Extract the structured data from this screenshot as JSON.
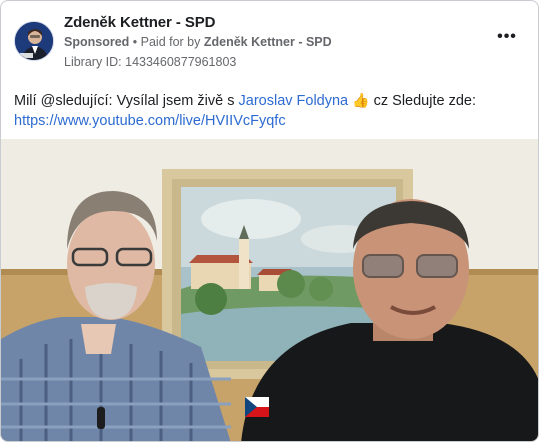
{
  "post": {
    "page_name": "Zdeněk Kettner - SPD",
    "sponsored_label": "Sponsored",
    "separator": " • ",
    "paid_for_prefix": "Paid for by ",
    "paid_for_by": "Zdeněk Kettner - SPD",
    "library_id": "Library ID: 1433460877961803",
    "more_icon_text": "•••",
    "text_prefix": "Milí ",
    "mention": "@sledující",
    "text_middle": ": Vysílal jsem živě s ",
    "linked_name": "Jaroslav Foldyna",
    "thumb_emoji": "👍",
    "text_suffix": " cz Sledujte zde:",
    "link": "https://www.youtube.com/live/HVIIVcFyqfc"
  },
  "colors": {
    "link": "#2d6bd1",
    "meta_text": "#65676b",
    "avatar_bg": "#1d3a7a"
  },
  "icons": {
    "more": "more-horizontal-icon"
  }
}
